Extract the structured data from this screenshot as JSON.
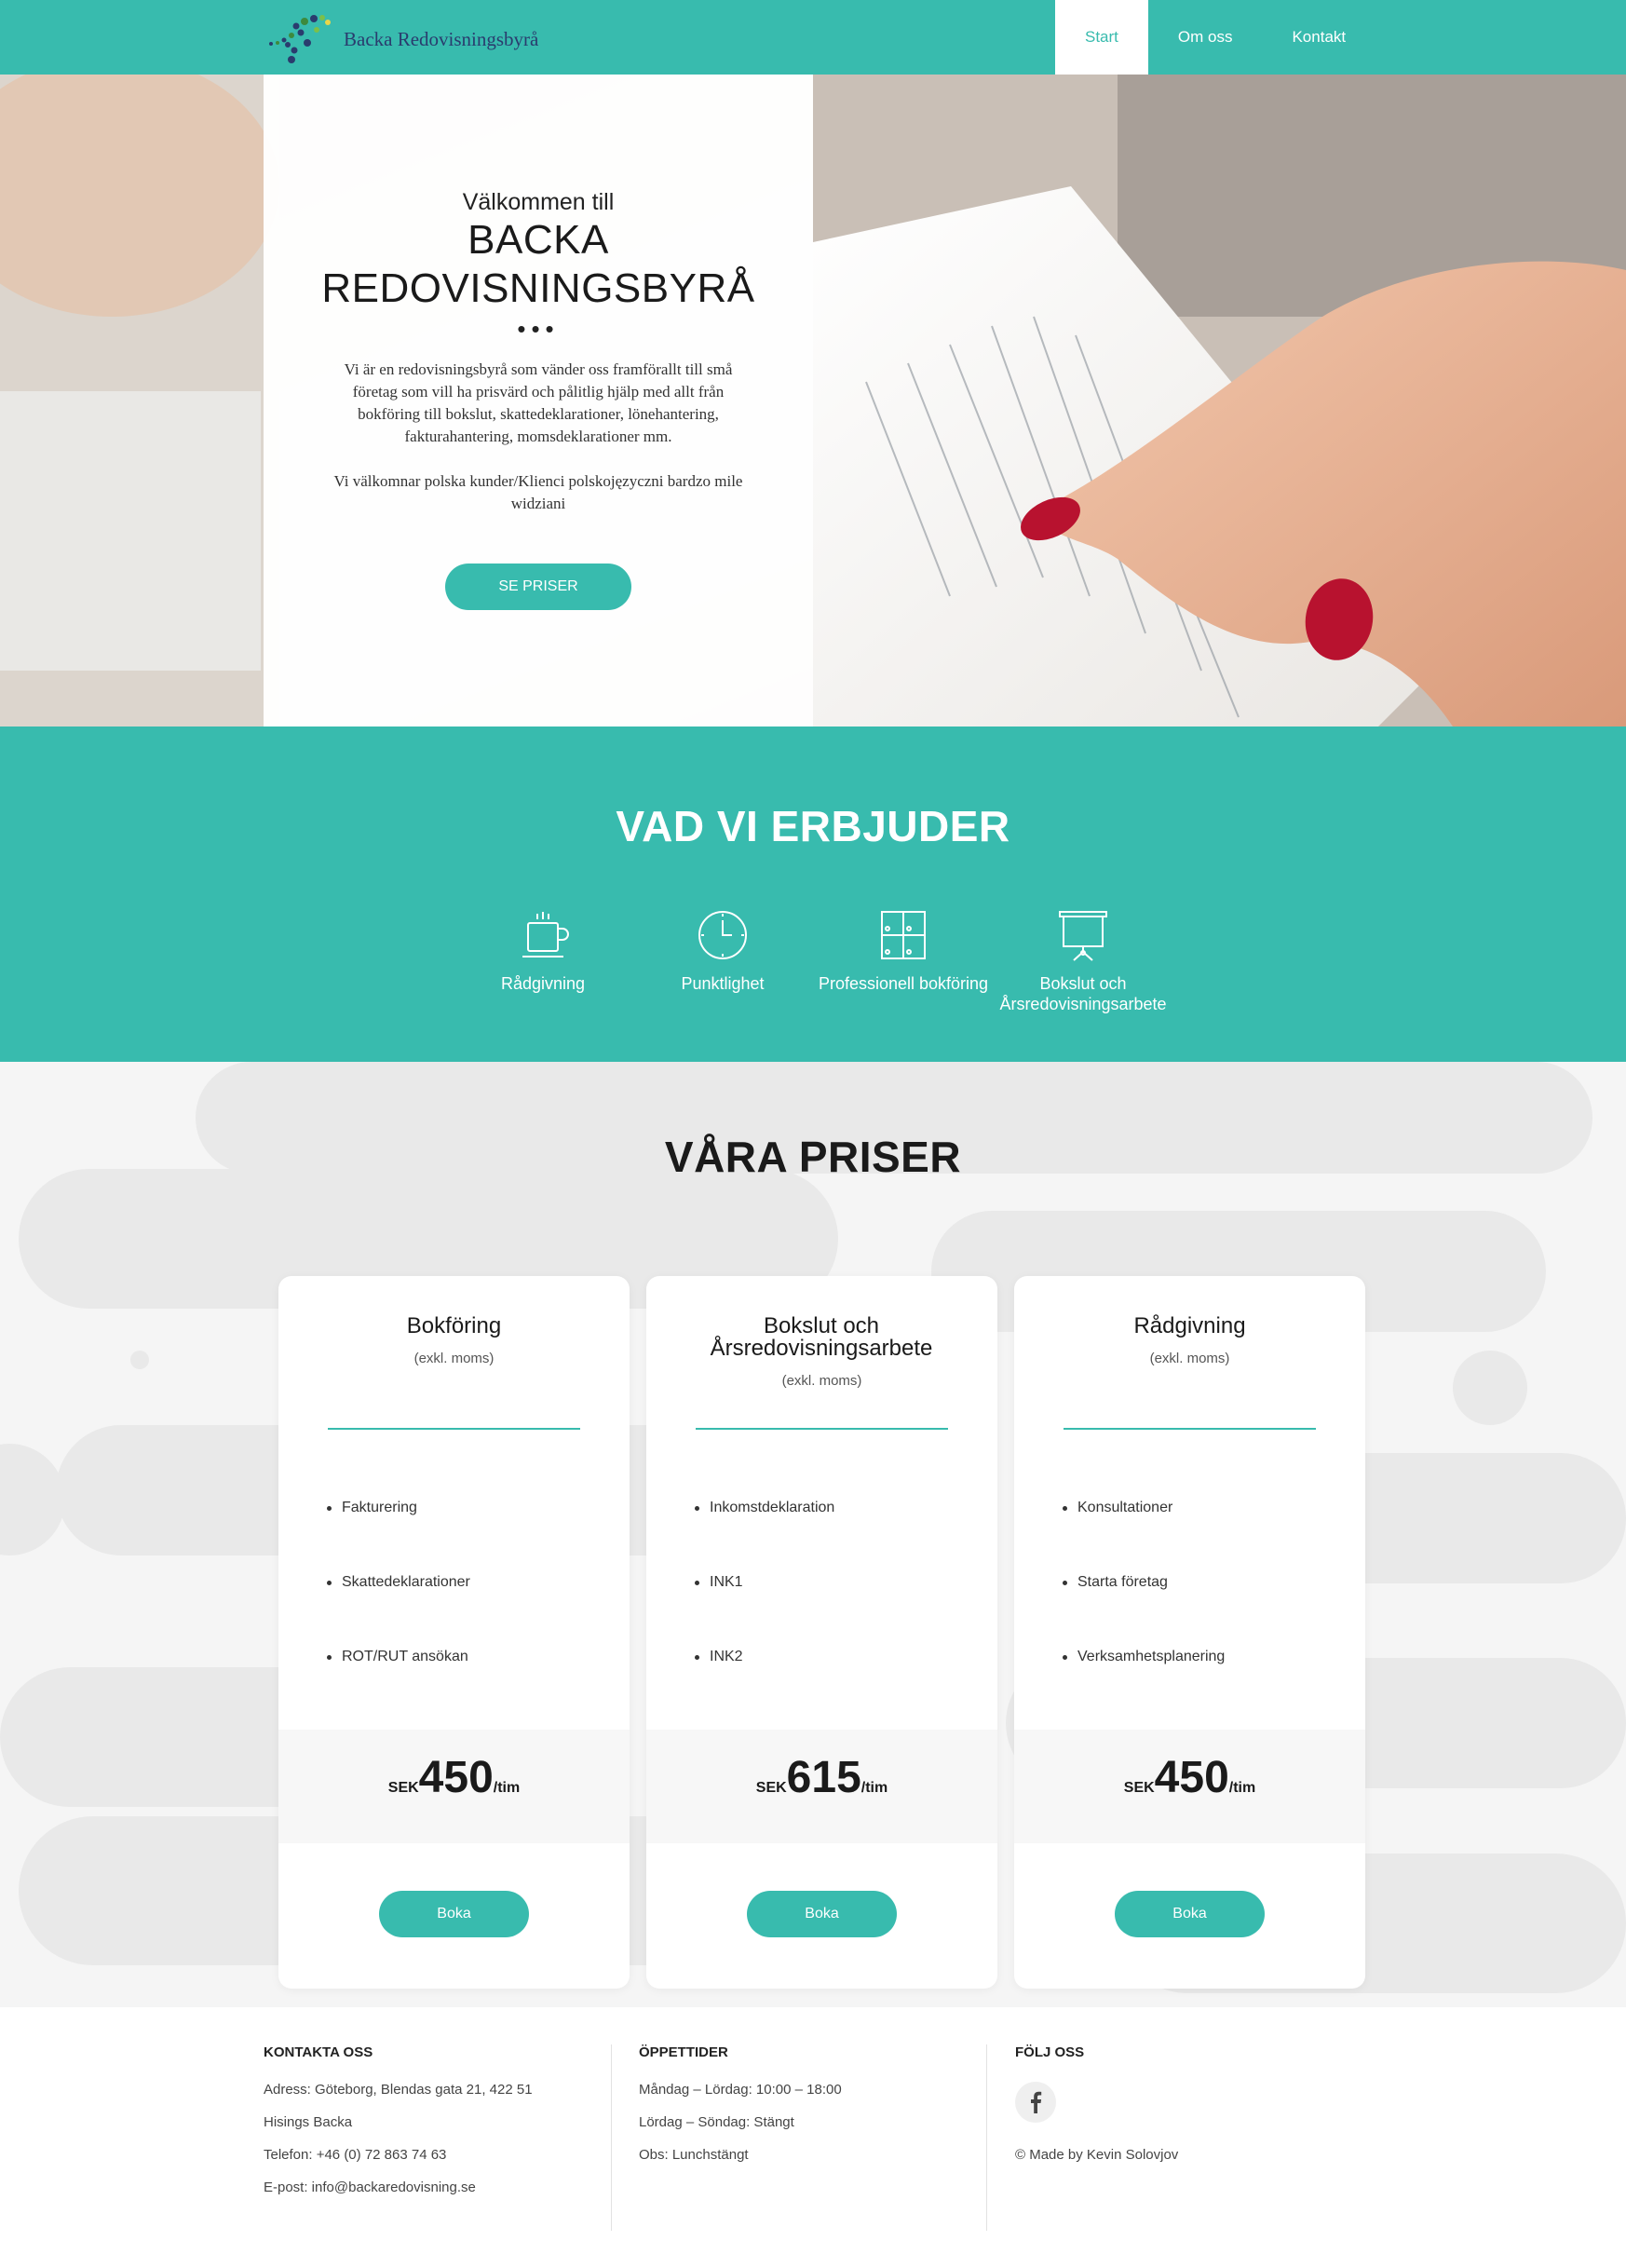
{
  "nav": {
    "logo_text": "Backa Redovisningsbyrå",
    "items": [
      {
        "label": "Start",
        "active": true
      },
      {
        "label": "Om oss",
        "active": false
      },
      {
        "label": "Kontakt",
        "active": false
      }
    ]
  },
  "hero": {
    "welcome": "Välkommen till",
    "title": "BACKA REDOVISNINGSBYRÅ",
    "dots": "•••",
    "description": "Vi är en redovisningsbyrå som vänder oss framförallt till små företag som vill ha prisvärd och pålitlig hjälp med allt från bokföring till bokslut, skattedeklarationer, lönehantering, fakturahantering, momsdeklarationer mm.",
    "description2": "Vi välkomnar polska kunder/Klienci polskojęzyczni bardzo mile widziani",
    "button": "SE PRISER"
  },
  "services": {
    "title": "VAD VI ERBJUDER",
    "items": [
      {
        "label": "Rådgivning",
        "icon": "coffee-cup-icon"
      },
      {
        "label": "Punktlighet",
        "icon": "clock-icon"
      },
      {
        "label": "Professionell bokföring",
        "icon": "ledger-grid-icon"
      },
      {
        "label": "Bokslut och Årsredovisningsarbete",
        "icon": "presentation-board-icon"
      }
    ]
  },
  "prices": {
    "title": "VÅRA PRISER",
    "cards": [
      {
        "title": "Bokföring",
        "subtitle": "(exkl. moms)",
        "features": [
          "Fakturering",
          "Skattedeklarationer",
          "ROT/RUT ansökan"
        ],
        "currency": "SEK",
        "price": "450",
        "unit": "/tim",
        "button": "Boka"
      },
      {
        "title": "Bokslut och Årsredovisningsarbete",
        "subtitle": "(exkl. moms)",
        "features": [
          "Inkomstdeklaration",
          "INK1",
          "INK2"
        ],
        "currency": "SEK",
        "price": "615",
        "unit": "/tim",
        "button": "Boka"
      },
      {
        "title": "Rådgivning",
        "subtitle": "(exkl. moms)",
        "features": [
          "Konsultationer",
          "Starta företag",
          "Verksamhetsplanering"
        ],
        "currency": "SEK",
        "price": "450",
        "unit": "/tim",
        "button": "Boka"
      }
    ]
  },
  "footer": {
    "contact": {
      "heading": "KONTAKTA OSS",
      "lines": [
        "Adress: Göteborg, Blendas gata 21, 422 51",
        "Hisings Backa",
        "Telefon: +46 (0) 72 863 74 63",
        "E-post: info@backaredovisning.se"
      ]
    },
    "hours": {
      "heading": "ÖPPETTIDER",
      "lines": [
        "Måndag – Lördag: 10:00 – 18:00",
        "Lördag – Söndag: Stängt",
        "Obs: Lunchstängt"
      ]
    },
    "follow": {
      "heading": "FÖLJ OSS",
      "social_icon": "facebook-icon",
      "copyright": "© Made by Kevin Solovjov"
    }
  },
  "colors": {
    "accent": "#38bbae",
    "dark_text": "#1a1a1a",
    "price_band": "#f7f7f7",
    "page_bg": "#f5f5f5"
  }
}
